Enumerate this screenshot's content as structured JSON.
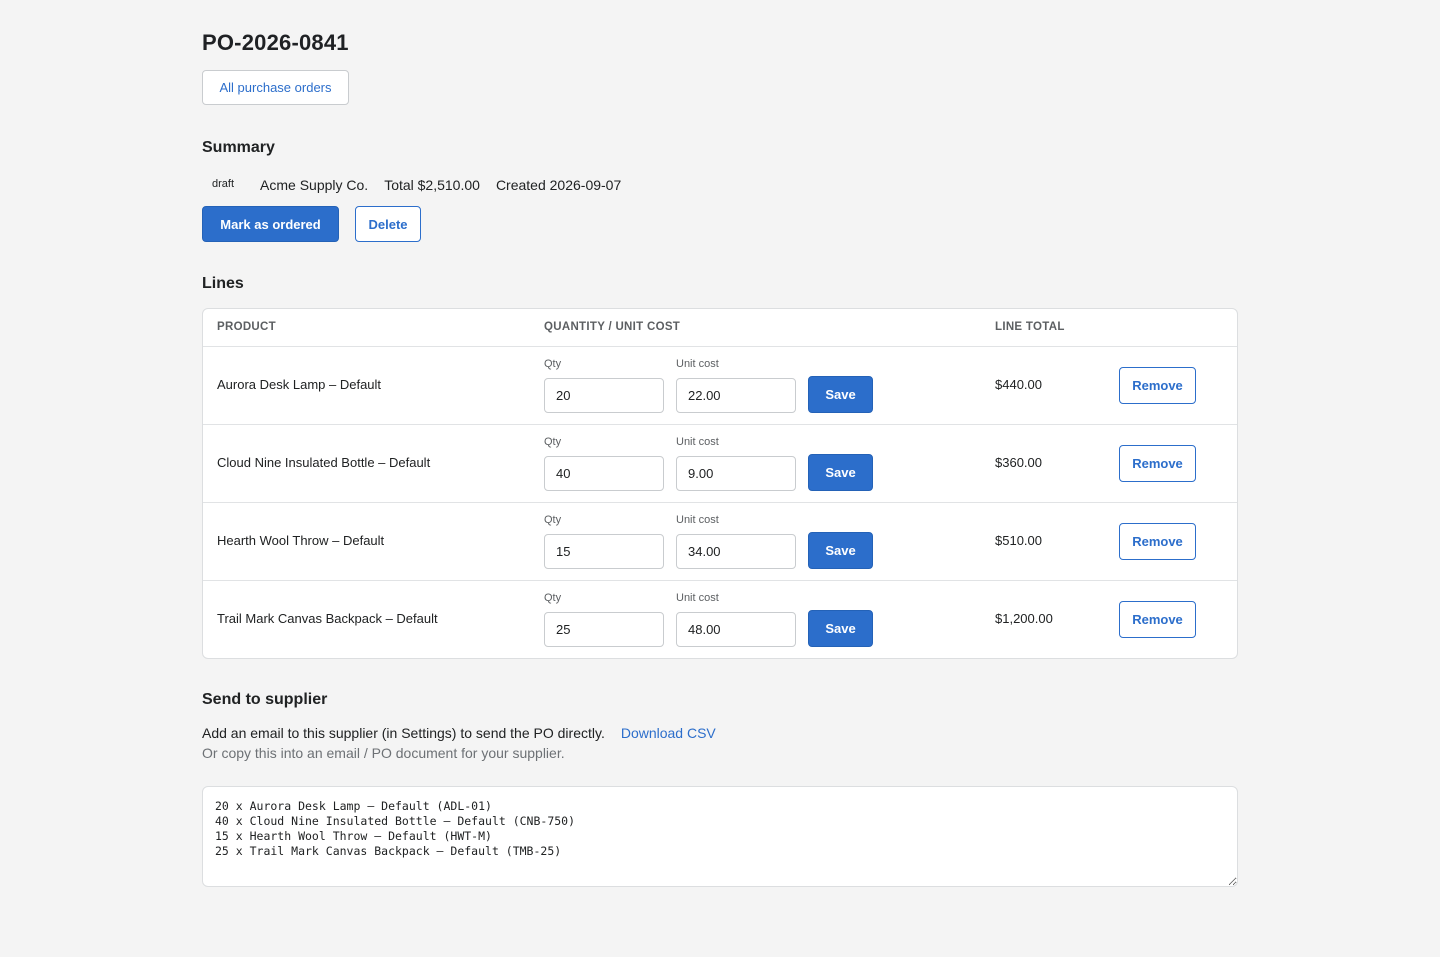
{
  "page": {
    "title": "PO-2026-0841",
    "back_label": "All purchase orders"
  },
  "summary": {
    "heading": "Summary",
    "status": "draft",
    "supplier": "Acme Supply Co.",
    "total": "Total $2,510.00",
    "created": "Created 2026-09-07",
    "mark_ordered_label": "Mark as ordered",
    "delete_label": "Delete"
  },
  "lines": {
    "heading": "Lines",
    "columns": [
      "PRODUCT",
      "QUANTITY / UNIT COST",
      "LINE TOTAL"
    ],
    "qty_label": "Qty",
    "unit_cost_label": "Unit cost",
    "save_label": "Save",
    "remove_label": "Remove",
    "rows": [
      {
        "product": "Aurora Desk Lamp – Default",
        "qty": "20",
        "unit_cost": "22.00",
        "line_total": "$440.00"
      },
      {
        "product": "Cloud Nine Insulated Bottle – Default",
        "qty": "40",
        "unit_cost": "9.00",
        "line_total": "$360.00"
      },
      {
        "product": "Hearth Wool Throw – Default",
        "qty": "15",
        "unit_cost": "34.00",
        "line_total": "$510.00"
      },
      {
        "product": "Trail Mark Canvas Backpack – Default",
        "qty": "25",
        "unit_cost": "48.00",
        "line_total": "$1,200.00"
      }
    ]
  },
  "send": {
    "heading": "Send to supplier",
    "info": "Add an email to this supplier (in Settings) to send the PO directly.",
    "download_label": "Download CSV",
    "hint": "Or copy this into an email / PO document for your supplier.",
    "copy_text": "20 x Aurora Desk Lamp – Default (ADL-01)\n40 x Cloud Nine Insulated Bottle – Default (CNB-750)\n15 x Hearth Wool Throw – Default (HWT-M)\n25 x Trail Mark Canvas Backpack – Default (TMB-25)"
  },
  "colors": {
    "accent": "#2c6ecb",
    "background": "#f4f4f4"
  }
}
